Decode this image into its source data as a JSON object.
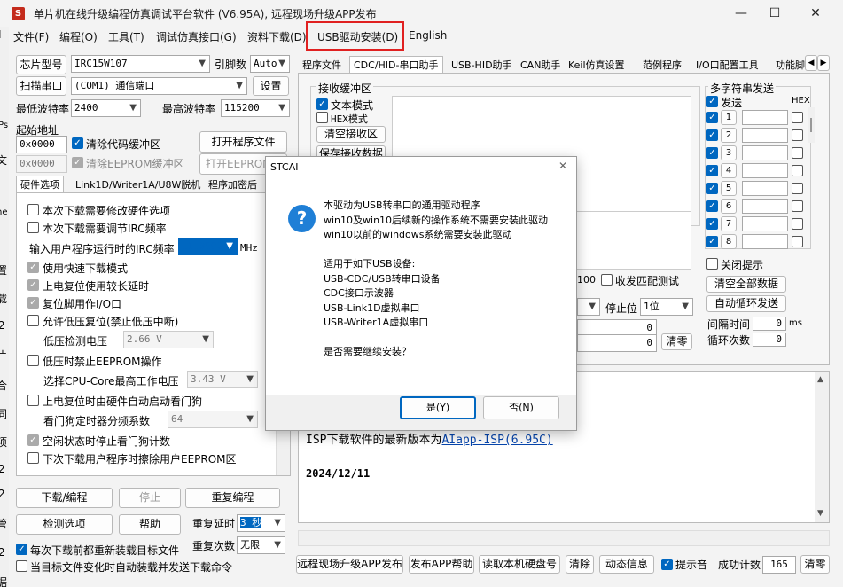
{
  "window": {
    "title": "单片机在线升级编程仿真调试平台软件 (V6.95A), 远程现场升级APP发布",
    "app_icon": "stc-app-icon",
    "minimize": "—",
    "maximize": "☐",
    "close": "✕"
  },
  "menubar": {
    "items": [
      "文件(F)",
      "编程(O)",
      "工具(T)",
      "调试仿真接口(G)",
      "资料下载(D)",
      "USB驱动安装(D)",
      "English"
    ]
  },
  "left": {
    "chip_label": "芯片型号",
    "chip_value": "IRC15W107",
    "pins_label": "引脚数",
    "pins_value": "Auto",
    "scan_btn": "扫描串口",
    "port_value": "(COM1) 通信端口",
    "settings_btn": "设置",
    "min_baud_label": "最低波特率",
    "min_baud_value": "2400",
    "max_baud_label": "最高波特率",
    "max_baud_value": "115200",
    "start_addr_label": "起始地址",
    "addr1": "0x0000",
    "clear_code_label": "清除代码缓冲区",
    "open_prog_btn": "打开程序文件",
    "addr2": "0x0000",
    "clear_eeprom_label": "清除EEPROM缓冲区",
    "open_eeprom_btn": "打开EEPROM文件",
    "tabs": [
      "硬件选项",
      "Link1D/Writer1A/U8W脱机",
      "程序加密后"
    ],
    "opts": {
      "o1": "本次下载需要修改硬件选项",
      "o2": "本次下载需要调节IRC频率",
      "irc_label": "输入用户程序运行时的IRC频率",
      "irc_value": "11.0592",
      "irc_unit": "MHz",
      "o3": "使用快速下载模式",
      "o4": "上电复位使用较长延时",
      "o5": "复位脚用作I/O口",
      "o6": "允许低压复位(禁止低压中断)",
      "lv_label": "低压检测电压",
      "lv_value": "2.66 V",
      "o7": "低压时禁止EEPROM操作",
      "cpu_label": "选择CPU-Core最高工作电压",
      "cpu_value": "3.43 V",
      "o8": "上电复位时由硬件自动启动看门狗",
      "wdt_label": "看门狗定时器分频系数",
      "wdt_value": "64",
      "o9": "空闲状态时停止看门狗计数",
      "o10": "下次下载用户程序时擦除用户EEPROM区"
    },
    "download_btn": "下载/编程",
    "stop_btn": "停止",
    "reprog_btn": "重复编程",
    "check_btn": "检测选项",
    "help_btn": "帮助",
    "repeat_delay_label": "重复延时",
    "repeat_delay_value": "3 秒",
    "repeat_count_label": "重复次数",
    "repeat_count_value": "无限",
    "reload_label": "每次下载前都重新装载目标文件",
    "autoload_label": "当目标文件变化时自动装载并发送下载命令"
  },
  "right": {
    "tabs": [
      "程序文件",
      "CDC/HID-串口助手",
      "USB-HID助手",
      "CAN助手",
      "Keil仿真设置",
      "范例程序",
      "I/O口配置工具",
      "功能脚"
    ],
    "recv_group": "接收缓冲区",
    "text_mode": "文本模式",
    "hex_mode": "HEX模式",
    "clear_recv_btn": "清空接收区",
    "save_recv_btn": "保存接收数据",
    "baud_partial": "100",
    "match_test": "收发匹配测试",
    "stop_bit_label": "停止位",
    "stop_bit_value": "1位",
    "count1": "0",
    "count2": "0",
    "clear_btn": "清零",
    "multi_group": "多字符串发送",
    "send_label": "发送",
    "hex_label": "HEX",
    "rows": [
      "1",
      "2",
      "3",
      "4",
      "5",
      "6",
      "7",
      "8"
    ],
    "close_tip": "关闭提示",
    "clear_all_btn": "清空全部数据",
    "auto_loop_btn": "自动循环发送",
    "interval_label": "间隔时间",
    "interval_value": "0",
    "interval_unit": "ms",
    "loop_count_label": "循环次数",
    "loop_count_value": "0",
    "log_line1_prefix": "ISP下载软件的最新版本为",
    "log_line1_link": "AIapp-ISP(6.95C)",
    "log_line2": "2024/12/11",
    "bottom": {
      "publish_btn": "远程现场升级APP发布",
      "publish_help_btn": "发布APP帮助",
      "read_disk_btn": "读取本机硬盘号",
      "clear_btn": "清除",
      "anim_btn": "动态信息",
      "beep_label": "提示音",
      "success_label": "成功计数",
      "success_value": "165",
      "reset_btn": "清零"
    }
  },
  "edge_chars": [
    "I",
    "Ps",
    "文",
    "ne",
    "置",
    "载",
    "2",
    "片",
    "合",
    "同",
    "项",
    "2",
    "2",
    "管",
    "2",
    "据"
  ],
  "dialog": {
    "title": "STCAI",
    "close": "✕",
    "icon": "question-icon",
    "lines": [
      "本驱动为USB转串口的通用驱动程序",
      "win10及win10后续新的操作系统不需要安装此驱动",
      "win10以前的windows系统需要安装此驱动",
      "",
      "适用于如下USB设备:",
      "USB-CDC/USB转串口设备",
      "CDC接口示波器",
      "USB-Link1D虚拟串口",
      "USB-Writer1A虚拟串口",
      "",
      "是否需要继续安装？"
    ],
    "yes_btn": "是(Y)",
    "no_btn": "否(N)"
  },
  "colors": {
    "highlight_box": "#e02020",
    "accent": "#0067c0",
    "link": "#0645ad"
  }
}
